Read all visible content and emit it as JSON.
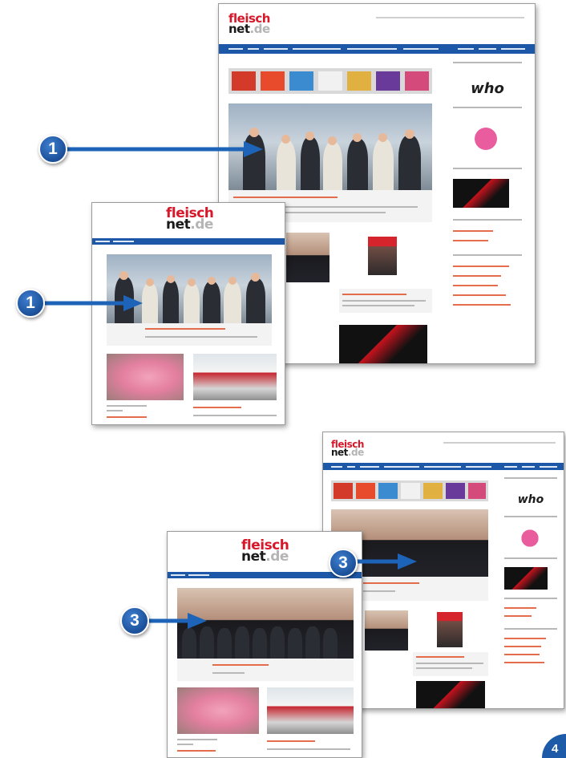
{
  "figure": {
    "callouts": [
      "1",
      "1",
      "3",
      "3"
    ],
    "page_marker": "4"
  },
  "brand": {
    "line1": "fleisch",
    "line2": "net",
    "tld": ".de"
  },
  "colors": {
    "brand_red": "#d7182a",
    "nav_blue": "#1d58a8",
    "callout_blue": "#1b4f98",
    "headline_orange": "#e2532b"
  }
}
